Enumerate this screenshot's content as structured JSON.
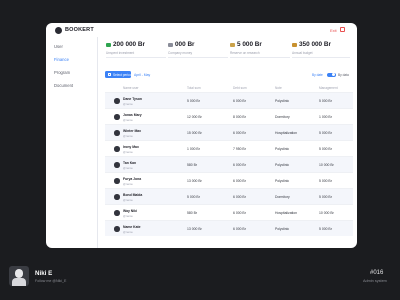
{
  "app": {
    "brand": "BOOKERT",
    "exit_label": "Exit"
  },
  "sidebar": {
    "items": [
      {
        "label": "User",
        "active": false
      },
      {
        "label": "Finance",
        "active": true
      },
      {
        "label": "Program",
        "active": false
      },
      {
        "label": "Document",
        "active": false
      }
    ]
  },
  "stats": [
    {
      "value": "200 000 Br",
      "label": "Unspent investment",
      "icon": "money-icon",
      "color": "#2ea44f"
    },
    {
      "value": "000 Br",
      "label": "Company money",
      "icon": "bank-icon",
      "color": "#8a8d99"
    },
    {
      "value": "5 000 Br",
      "label": "Reserve on research",
      "icon": "card-icon",
      "color": "#caa24a"
    },
    {
      "value": "350 000 Br",
      "label": "Annual budget",
      "icon": "bag-icon",
      "color": "#c8912f"
    }
  ],
  "toolbar": {
    "add_button": "Select period",
    "filter": "April - May",
    "toggle_left": "By date",
    "toggle_right": "By data"
  },
  "table": {
    "headers": [
      "Name user",
      "Total sum",
      "Debt sum",
      "Note",
      "Management"
    ],
    "rows": [
      {
        "name": "Dane Tyson",
        "handle": "@name",
        "total": "5 000 Br",
        "debt": "6 000 Br",
        "note": "Polyclinic",
        "mgmt": "5 000 Br"
      },
      {
        "name": "Jonas Mary",
        "handle": "@name",
        "total": "12 000 Br",
        "debt": "8 000 Br",
        "note": "Dormitory",
        "mgmt": "1 000 Br"
      },
      {
        "name": "Winter Max",
        "handle": "@name",
        "total": "15 000 Br",
        "debt": "6 000 Br",
        "note": "Hospitalization",
        "mgmt": "5 000 Br"
      },
      {
        "name": "Irony Max",
        "handle": "@name",
        "total": "1 000 Br",
        "debt": "7 950 Br",
        "note": "Polyclinic",
        "mgmt": "5 000 Br"
      },
      {
        "name": "Tan Kan",
        "handle": "@name",
        "total": "580 Br",
        "debt": "6 000 Br",
        "note": "Polyclinic",
        "mgmt": "10 000 Br"
      },
      {
        "name": "Furya Jona",
        "handle": "@name",
        "total": "13 000 Br",
        "debt": "6 000 Br",
        "note": "Polyclinic",
        "mgmt": "5 000 Br"
      },
      {
        "name": "Bond Mabla",
        "handle": "@name",
        "total": "5 000 Br",
        "debt": "6 000 Br",
        "note": "Dormitory",
        "mgmt": "5 000 Br"
      },
      {
        "name": "Way Niki",
        "handle": "@name",
        "total": "580 Br",
        "debt": "6 000 Br",
        "note": "Hospitalization",
        "mgmt": "10 000 Br"
      },
      {
        "name": "Name Kate",
        "handle": "@name",
        "total": "13 000 Br",
        "debt": "6 000 Br",
        "note": "Polyclinic",
        "mgmt": "5 000 Br"
      }
    ]
  },
  "footer": {
    "author_name": "Niki E",
    "author_follow": "Follow me @Niki_E",
    "shot_number": "#016",
    "shot_subtitle": "Admin system"
  },
  "colors": {
    "accent": "#3b82f6",
    "danger": "#e85050",
    "background": "#1b1c1f"
  }
}
